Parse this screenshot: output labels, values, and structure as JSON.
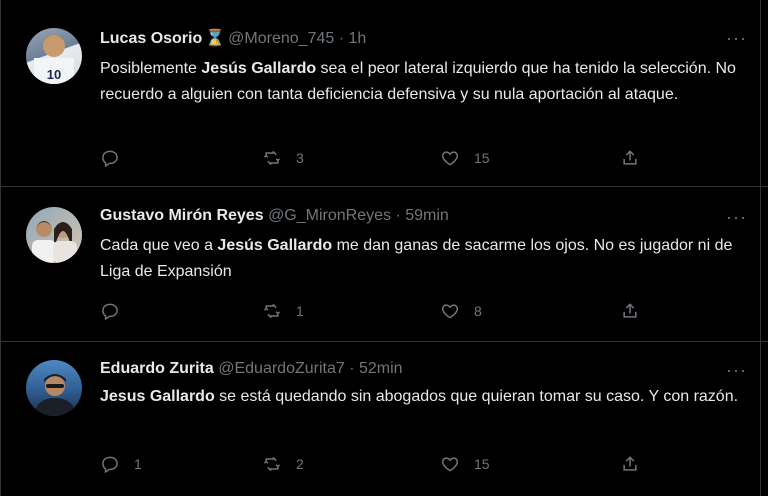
{
  "tweets": [
    {
      "name": "Lucas Osorio",
      "badge": "hourglass-icon",
      "handle": "@Moreno_745",
      "sep": "·",
      "time": "1h",
      "body": [
        {
          "t": "Posiblemente "
        },
        {
          "t": "Jesús Gallardo",
          "b": true
        },
        {
          "t": " sea el peor lateral izquierdo que ha tenido la selección. No recuerdo a alguien con tanta deficiencia defensiva y su nula aportación al ataque."
        }
      ],
      "replies": "",
      "retweets": "3",
      "likes": "15"
    },
    {
      "name": "Gustavo Mirón Reyes",
      "handle": "@G_MironReyes",
      "sep": "·",
      "time": "59min",
      "body": [
        {
          "t": "Cada que veo a "
        },
        {
          "t": "Jesús Gallardo",
          "b": true
        },
        {
          "t": " me dan ganas de sacarme los ojos. No es jugador ni de Liga de Expansión"
        }
      ],
      "replies": "",
      "retweets": "1",
      "likes": "8"
    },
    {
      "name": "Eduardo Zurita",
      "handle": "@EduardoZurita7",
      "sep": "·",
      "time": "52min",
      "body": [
        {
          "t": "Jesus Gallardo",
          "b": true
        },
        {
          "t": " se está quedando sin abogados que quieran tomar su caso. Y con razón."
        }
      ],
      "replies": "1",
      "retweets": "2",
      "likes": "15"
    }
  ],
  "more_label": "···",
  "colors": {
    "background": "#000000",
    "text": "#e7e9ea",
    "muted": "#71767b",
    "divider": "#2f3336",
    "hourglass": "#e0a43c"
  }
}
